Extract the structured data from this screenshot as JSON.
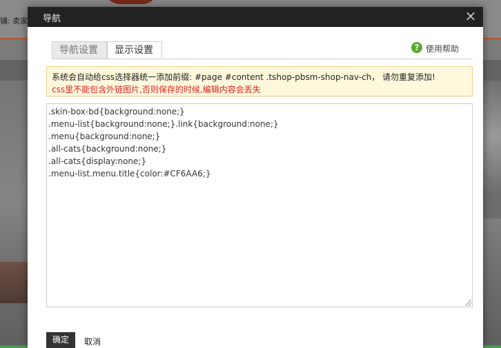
{
  "background_page": {
    "shop_text": "铺: 卖家的"
  },
  "dialog": {
    "title": "导航",
    "close_symbol": "×",
    "tabs": [
      {
        "label": "导航设置",
        "active": false
      },
      {
        "label": "显示设置",
        "active": true
      }
    ],
    "help": {
      "icon": "question-icon",
      "icon_glyph": "?",
      "label": "使用帮助",
      "icon_color": "#57a92e"
    },
    "notice": {
      "line1": "系统会自动给css选择器统一添加前缀: #page #content .tshop-pbsm-shop-nav-ch， 请勿重复添加!",
      "line2": "css里不能包含外链图片,否则保存的时候,编辑内容会丢失",
      "line2_color": "#dd2222"
    },
    "css_lines": [
      ".skin-box-bd{background:none;}",
      ".menu-list{background:none;}.link{background:none;}",
      ".menu{background:none;}",
      ".all-cats{background:none;}",
      ".all-cats{display:none;}",
      ".menu-list.menu.title{color:#CF6AA6;}"
    ],
    "buttons": {
      "ok": "确定",
      "cancel": "取消"
    }
  }
}
